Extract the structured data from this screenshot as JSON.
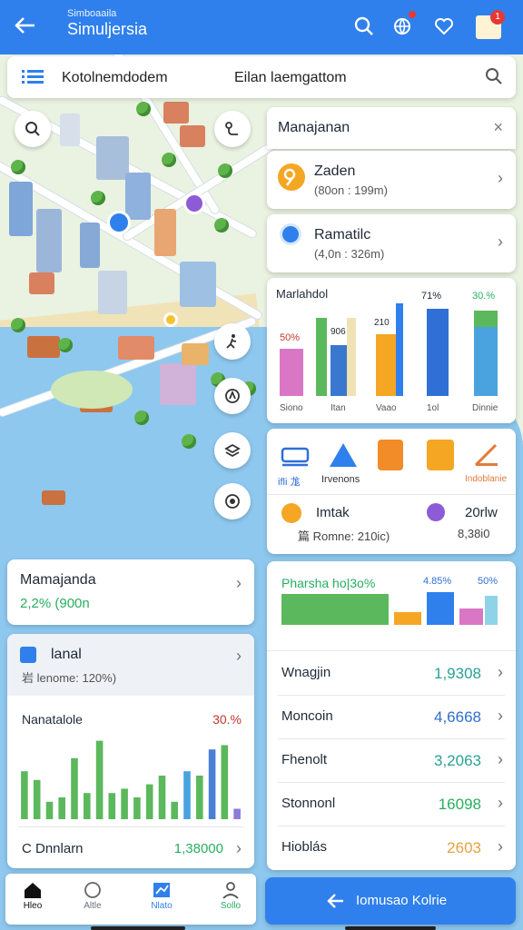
{
  "topbar": {
    "app_subtitle": "Simboaaila",
    "app_title": "Simuljersia",
    "notification_count": "1"
  },
  "search": {
    "query": "Kotolnemdodem",
    "secondary": "Eilan laemgattom"
  },
  "panel_header": {
    "title": "Manajanan"
  },
  "locations": [
    {
      "title": "Zaden",
      "subtitle": "(80on : 199m)"
    },
    {
      "title": "Ramatilc",
      "subtitle": "(4,0n : 326m)"
    }
  ],
  "mini_chart": {
    "title": "Marlahdol",
    "top_labels": [
      "71%",
      "30.%"
    ],
    "side_labels": [
      "50%",
      "906",
      "210"
    ],
    "categories": [
      "Siono",
      "Itan",
      "Vaao",
      "1ol",
      "Dinnie"
    ]
  },
  "tools": {
    "labels": [
      "ifli 尨",
      "Irvenons",
      "Indoblanie"
    ],
    "row_left_title": "Imtak",
    "row_left_sub": "篇 Romne: 210ic)",
    "row_right_title": "20rlw",
    "row_right_sub": "8,38i0"
  },
  "left_summary": {
    "title": "Mamajanda",
    "subtitle": "2,2% (900n"
  },
  "left_detail": {
    "title": "lanal",
    "subtitle": "岩 lenome: 120%)",
    "chart_title": "Nanatalole",
    "chart_pct": "30.%",
    "footer_label": "C Dnnlarn",
    "footer_value": "1,38000"
  },
  "chart_data": {
    "type": "bar",
    "values": [
      0.55,
      0.45,
      0.2,
      0.25,
      0.7,
      0.3,
      0.9,
      0.3,
      0.35,
      0.25,
      0.4,
      0.5,
      0.2,
      0.55,
      0.5,
      0.8,
      0.85,
      0.12
    ],
    "colors": [
      "#5cb85c",
      "#5cb85c",
      "#5cb85c",
      "#5cb85c",
      "#5cb85c",
      "#5cb85c",
      "#5cb85c",
      "#5cb85c",
      "#5cb85c",
      "#5cb85c",
      "#5cb85c",
      "#5cb85c",
      "#5cb85c",
      "#4aa3df",
      "#5cb85c",
      "#4a7fd6",
      "#5cb85c",
      "#8e7cd8"
    ]
  },
  "right_stats": {
    "title": "Pharsha ho|3o%",
    "sub_mark": "%",
    "pct_a": "4.85%",
    "pct_b": "50%",
    "rows": [
      {
        "label": "Wnagjin",
        "value": "1,9308",
        "color": "#2aa198"
      },
      {
        "label": "Moncoin",
        "value": "4,6668",
        "color": "#2f6fc9"
      },
      {
        "label": "Fhenolt",
        "value": "3,2063",
        "color": "#2aa198"
      },
      {
        "label": "Stonnonl",
        "value": "16098",
        "color": "#27ae60"
      },
      {
        "label": "Hioblás",
        "value": "2603",
        "color": "#e6a23c"
      }
    ]
  },
  "bottom_nav": {
    "items": [
      {
        "label": "Hleo"
      },
      {
        "label": "Altle"
      },
      {
        "label": "Nlato"
      },
      {
        "label": "Sollo"
      }
    ]
  },
  "cta": {
    "label": "Iomusao Kolrie"
  }
}
